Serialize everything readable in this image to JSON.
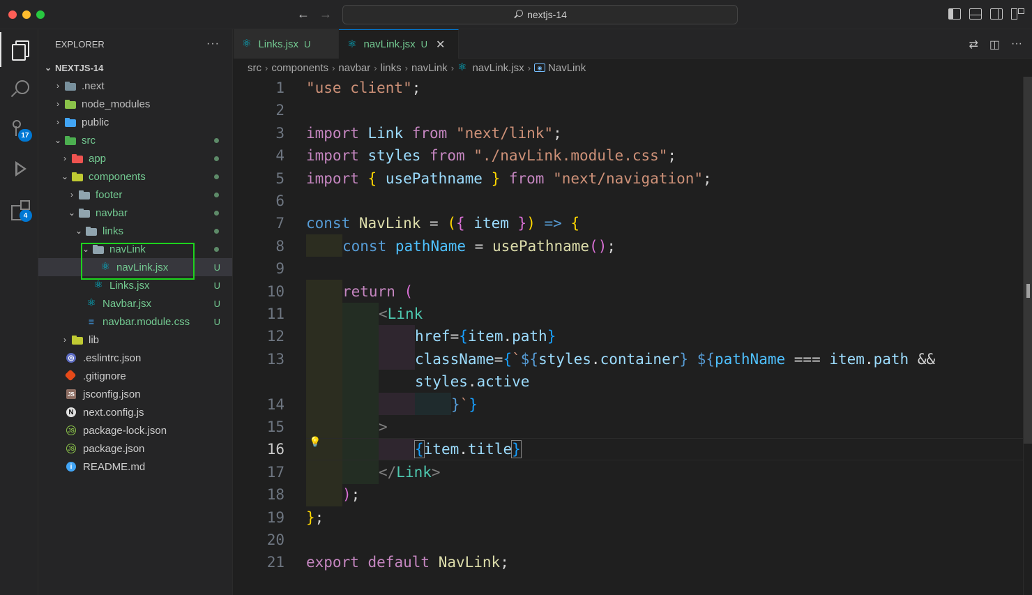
{
  "window": {
    "command_center": "nextjs-14"
  },
  "activity": {
    "scm_badge": "17",
    "extensions_badge": "4"
  },
  "explorer": {
    "header": "EXPLORER",
    "more": "···",
    "project": "NEXTJS-14",
    "items": [
      {
        "label": ".next",
        "status": ""
      },
      {
        "label": "node_modules",
        "status": ""
      },
      {
        "label": "public",
        "status": ""
      },
      {
        "label": "src",
        "status": "•"
      },
      {
        "label": "app",
        "status": "•"
      },
      {
        "label": "components",
        "status": "•"
      },
      {
        "label": "footer",
        "status": "•"
      },
      {
        "label": "navbar",
        "status": "•"
      },
      {
        "label": "links",
        "status": "•"
      },
      {
        "label": "navLink",
        "status": "•"
      },
      {
        "label": "navLink.jsx",
        "status": "U"
      },
      {
        "label": "Links.jsx",
        "status": "U"
      },
      {
        "label": "Navbar.jsx",
        "status": "U"
      },
      {
        "label": "navbar.module.css",
        "status": "U"
      },
      {
        "label": "lib",
        "status": ""
      },
      {
        "label": ".eslintrc.json",
        "status": ""
      },
      {
        "label": ".gitignore",
        "status": ""
      },
      {
        "label": "jsconfig.json",
        "status": ""
      },
      {
        "label": "next.config.js",
        "status": ""
      },
      {
        "label": "package-lock.json",
        "status": ""
      },
      {
        "label": "package.json",
        "status": ""
      },
      {
        "label": "README.md",
        "status": ""
      }
    ]
  },
  "tabs": [
    {
      "label": "Links.jsx",
      "status": "U"
    },
    {
      "label": "navLink.jsx",
      "status": "U",
      "close": "✕"
    }
  ],
  "breadcrumb": [
    "src",
    "components",
    "navbar",
    "links",
    "navLink",
    "navLink.jsx",
    "NavLink"
  ],
  "editor": {
    "line_numbers": [
      "1",
      "2",
      "3",
      "4",
      "5",
      "6",
      "7",
      "8",
      "9",
      "10",
      "11",
      "12",
      "13",
      "14",
      "15",
      "16",
      "17",
      "18",
      "19",
      "20",
      "21"
    ],
    "current_line": "16"
  },
  "colors": {
    "accent": "#0078d4",
    "untracked": "#73c991",
    "highlight_box": "#1ed41e"
  }
}
